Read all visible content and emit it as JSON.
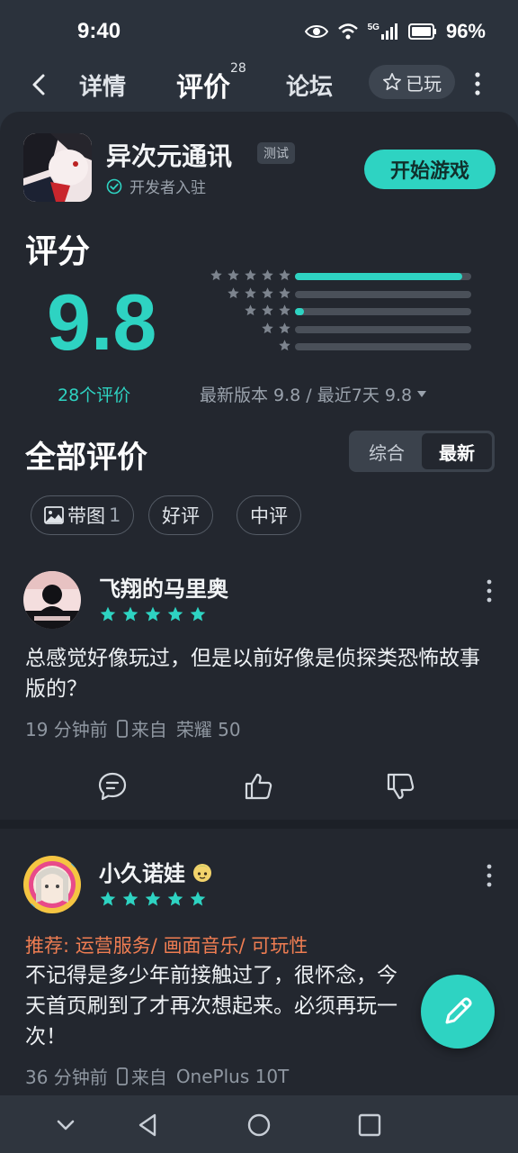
{
  "status_bar": {
    "time": "9:40",
    "network": "5G",
    "battery": "96%"
  },
  "nav": {
    "tabs": [
      {
        "label": "详情"
      },
      {
        "label": "评价",
        "badge": "28"
      },
      {
        "label": "论坛"
      }
    ],
    "played_label": "已玩"
  },
  "app": {
    "name": "异次元通讯",
    "badge": "测试",
    "developer_label": "开发者入驻",
    "start_button": "开始游戏"
  },
  "rating": {
    "title": "评分",
    "score": "9.8",
    "count_label": "28个评价",
    "distribution": [
      {
        "stars": 5,
        "fraction": 0.95
      },
      {
        "stars": 4,
        "fraction": 0.0
      },
      {
        "stars": 3,
        "fraction": 0.05
      },
      {
        "stars": 2,
        "fraction": 0.0
      },
      {
        "stars": 1,
        "fraction": 0.0
      }
    ],
    "version_line": "最新版本 9.8 / 最近7天 9.8"
  },
  "reviews_section": {
    "title": "全部评价",
    "sort_options": [
      "综合",
      "最新"
    ],
    "active_sort": "最新",
    "filters": [
      {
        "label": "带图",
        "count": "1"
      },
      {
        "label": "好评"
      },
      {
        "label": "中评"
      }
    ]
  },
  "reviews": [
    {
      "user": "飞翔的马里奥",
      "stars": 5,
      "text": "总感觉好像玩过，但是以前好像是侦探类恐怖故事版的？",
      "time": "19 分钟前",
      "device_prefix": "来自",
      "device": "荣耀 50"
    },
    {
      "user": "小久诺娃",
      "stars": 5,
      "recommend": "推荐: 运营服务/ 画面音乐/ 可玩性",
      "text": "不记得是多少年前接触过了，很怀念，今天首页刷到了才再次想起来。必须再玩一次！",
      "time": "36 分钟前",
      "device_prefix": "来自",
      "device": "OnePlus 10T"
    }
  ],
  "colors": {
    "accent": "#2ed3c2",
    "background": "#23272f",
    "recommend": "#ef7d52"
  }
}
